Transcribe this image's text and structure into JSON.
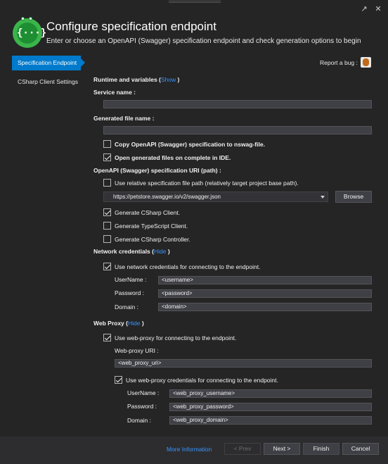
{
  "window": {
    "restore_icon": "pin-icon",
    "close_icon": "close-icon"
  },
  "header": {
    "title": "Configure specification endpoint",
    "subtitle": "Enter or choose an OpenAPI (Swagger) specification endpoint and check generation options to begin",
    "logo_glyph": "{···}"
  },
  "nav": {
    "items": [
      {
        "label": "Specification Endpoint",
        "active": true
      },
      {
        "label": "CSharp Client Settings",
        "active": false
      }
    ]
  },
  "report_bug": {
    "label": "Report a bug :",
    "icon": "bug-icon"
  },
  "form": {
    "runtime": {
      "label": "Runtime and variables (",
      "link": "Show",
      "close": " )"
    },
    "service_name": {
      "label": "Service name :",
      "value": ""
    },
    "generated_file_name": {
      "label": "Generated file name :",
      "value": ""
    },
    "copy_spec": {
      "label": "Copy OpenAPI (Swagger) specification to nswag-file.",
      "checked": false
    },
    "open_generated": {
      "label": "Open generated files on complete in IDE.",
      "checked": true
    },
    "uri_section": {
      "label": "OpenAPI (Swagger) specification URI (path) :"
    },
    "use_relative": {
      "label": "Use relative specification file path (relatively target project base path).",
      "checked": false
    },
    "uri_value": "https://petstore.swagger.io/v2/swagger.json",
    "browse_label": "Browse",
    "gen_csharp_client": {
      "label": "Generate CSharp Client.",
      "checked": true
    },
    "gen_typescript_client": {
      "label": "Generate TypeScript Client.",
      "checked": false
    },
    "gen_csharp_controller": {
      "label": "Generate CSharp Controller.",
      "checked": false
    },
    "network": {
      "label": "Network credentials (",
      "link": "Hide",
      "close": " )",
      "use_label": "Use network credentials for connecting to the endpoint.",
      "use_checked": true,
      "username_label": "UserName :",
      "username_value": "<username>",
      "password_label": "Password :",
      "password_value": "<password>",
      "domain_label": "Domain :",
      "domain_value": "<domain>"
    },
    "proxy": {
      "label": "Web Proxy (",
      "link": "Hide",
      "close": " )",
      "use_label": "Use web-proxy for connecting to the endpoint.",
      "use_checked": true,
      "uri_label": "Web-proxy URI :",
      "uri_value": "<web_proxy_uri>",
      "cred_label": "Use web-proxy credentials for connecting to the endpoint.",
      "cred_checked": true,
      "username_label": "UserName :",
      "username_value": "<web_proxy_username>",
      "password_label": "Password :",
      "password_value": "<web_proxy_password>",
      "domain_label": "Domain :",
      "domain_value": "<web_proxy_domain>"
    }
  },
  "footer": {
    "more_info": "More Information",
    "prev": "< Prev",
    "next": "Next >",
    "finish": "Finish",
    "cancel": "Cancel"
  },
  "colors": {
    "background": "#252526",
    "accent": "#007acc",
    "link": "#3794ff",
    "logo": "#3bb54a"
  }
}
